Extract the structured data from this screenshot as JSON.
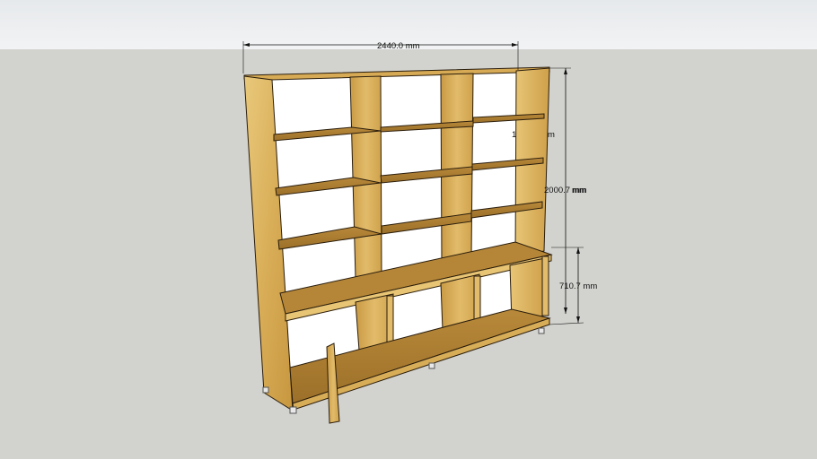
{
  "viewport": {
    "sky_color": "#eceef0",
    "ground_color": "#d2d2cf"
  },
  "model": {
    "wood_light": "#e8c879",
    "wood_mid": "#d2a64e",
    "wood_dark": "#a77a2c",
    "edge_color": "#2a1d0c"
  },
  "dimensions": {
    "width_label": "2440.0 mm",
    "height_label": "2000.7 mm",
    "height_label_overlap": "mm",
    "desk_height_label": "710.7 mm",
    "partial_top": "1",
    "partial_right": "m"
  }
}
